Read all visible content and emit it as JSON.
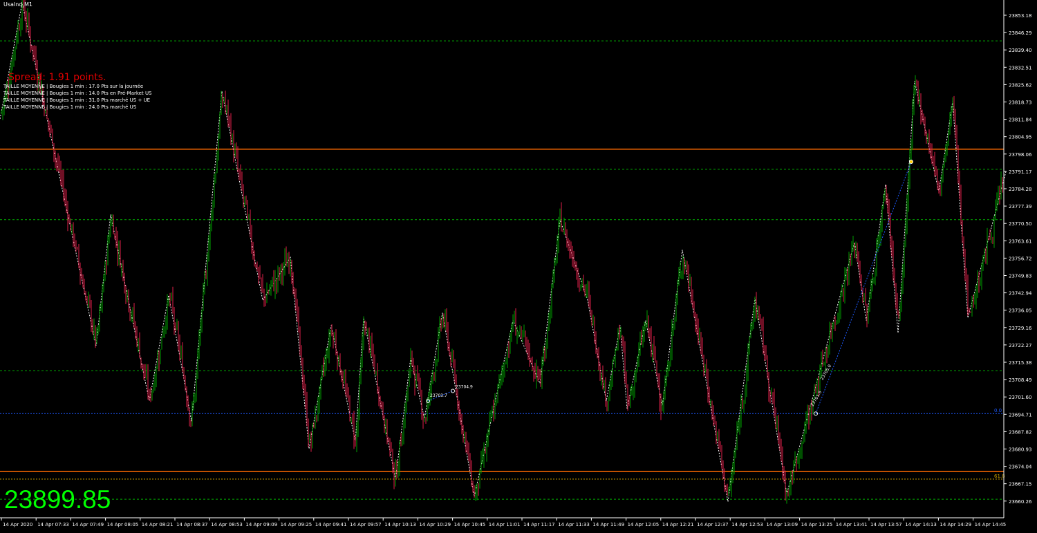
{
  "window": {
    "symbol_title": "UsaInd,M1"
  },
  "overlay": {
    "spread_text": "Spread: 1.91 points.",
    "info_lines": [
      "TAILLE MOYENNE | Bougies 1 min : 17.0 Pts sur la journée",
      "TAILLE MOYENNE | Bougies 1 min : 14.0 Pts en Pré-Market US",
      "TAILLE MOYENNE | Bougies 1 min : 31.0 Pts marché US + UE",
      "TAILLE MOYENNE | Bougies 1 min : 24.0 Pts marché US"
    ],
    "big_price": "23899.85"
  },
  "colors": {
    "background": "#000000",
    "bull": "#00a000",
    "bear": "#e0204a",
    "grid_green": "#00b000",
    "level_orange": "#ff6a00",
    "fib_blue": "#1e5aff",
    "zigzag": "#ffffff",
    "axis_text": "#ffffff"
  },
  "price_axis": {
    "labels": [
      "23853.18",
      "23846.29",
      "23839.40",
      "23832.51",
      "23825.62",
      "23818.73",
      "23811.84",
      "23804.95",
      "23798.06",
      "23791.17",
      "23784.28",
      "23777.39",
      "23770.50",
      "23763.61",
      "23756.72",
      "23749.83",
      "23742.94",
      "23736.05",
      "23729.16",
      "23722.27",
      "23715.38",
      "23708.49",
      "23701.60",
      "23694.71",
      "23687.82",
      "23680.93",
      "23674.04",
      "23667.15",
      "23660.26"
    ]
  },
  "time_axis": {
    "labels": [
      "14 Apr 2020",
      "14 Apr 07:33",
      "14 Apr 07:49",
      "14 Apr 08:05",
      "14 Apr 08:21",
      "14 Apr 08:37",
      "14 Apr 08:53",
      "14 Apr 09:09",
      "14 Apr 09:25",
      "14 Apr 09:41",
      "14 Apr 09:57",
      "14 Apr 10:13",
      "14 Apr 10:29",
      "14 Apr 10:45",
      "14 Apr 11:01",
      "14 Apr 11:17",
      "14 Apr 11:33",
      "14 Apr 11:49",
      "14 Apr 12:05",
      "14 Apr 12:21",
      "14 Apr 12:37",
      "14 Apr 12:53",
      "14 Apr 13:09",
      "14 Apr 13:25",
      "14 Apr 13:41",
      "14 Apr 13:57",
      "14 Apr 14:13",
      "14 Apr 14:29",
      "14 Apr 14:45"
    ]
  },
  "levels": {
    "green_dashed": [
      23843.0,
      23792.0,
      23772.0,
      23712.0,
      23661.0
    ],
    "orange_solid": [
      23800.0,
      23672.0
    ],
    "blue_dotted": [
      23695.0
    ],
    "yellow_dotted": [
      23669.0
    ],
    "fib_label_upper": "0.0",
    "fib_label_lower": "61.8"
  },
  "annotations": {
    "trendline_label_1": "23703.7",
    "trendline_label_2": "23704.9",
    "trendline_label_3": "23701.6",
    "trendline_label_4": "23705.0"
  },
  "zigzag_points": [
    [
      0,
      23812
    ],
    [
      32,
      23858
    ],
    [
      87,
      23788
    ],
    [
      139,
      23722
    ],
    [
      160,
      23774
    ],
    [
      216,
      23700
    ],
    [
      244,
      23742
    ],
    [
      277,
      23692
    ],
    [
      321,
      23823
    ],
    [
      380,
      23740
    ],
    [
      420,
      23757
    ],
    [
      447,
      23681
    ],
    [
      479,
      23730
    ],
    [
      514,
      23684
    ],
    [
      526,
      23733
    ],
    [
      572,
      23669
    ],
    [
      594,
      23717
    ],
    [
      614,
      23693
    ],
    [
      640,
      23735
    ],
    [
      686,
      23662
    ],
    [
      742,
      23732
    ],
    [
      781,
      23707
    ],
    [
      810,
      23772
    ],
    [
      850,
      23740
    ],
    [
      877,
      23700
    ],
    [
      897,
      23730
    ],
    [
      907,
      23697
    ],
    [
      934,
      23732
    ],
    [
      958,
      23698
    ],
    [
      987,
      23760
    ],
    [
      1053,
      23660
    ],
    [
      1092,
      23741
    ],
    [
      1138,
      23663
    ],
    [
      1236,
      23763
    ],
    [
      1253,
      23732
    ],
    [
      1281,
      23786
    ],
    [
      1299,
      23727
    ],
    [
      1323,
      23827
    ],
    [
      1358,
      23783
    ],
    [
      1378,
      23819
    ],
    [
      1400,
      23733
    ],
    [
      1455,
      23791
    ]
  ],
  "chart_data": {
    "type": "candlestick",
    "title": "UsaInd,M1",
    "xlabel": "",
    "ylabel": "",
    "ylim": [
      23656.0,
      23860.0
    ],
    "close_price": 23899.85
  }
}
